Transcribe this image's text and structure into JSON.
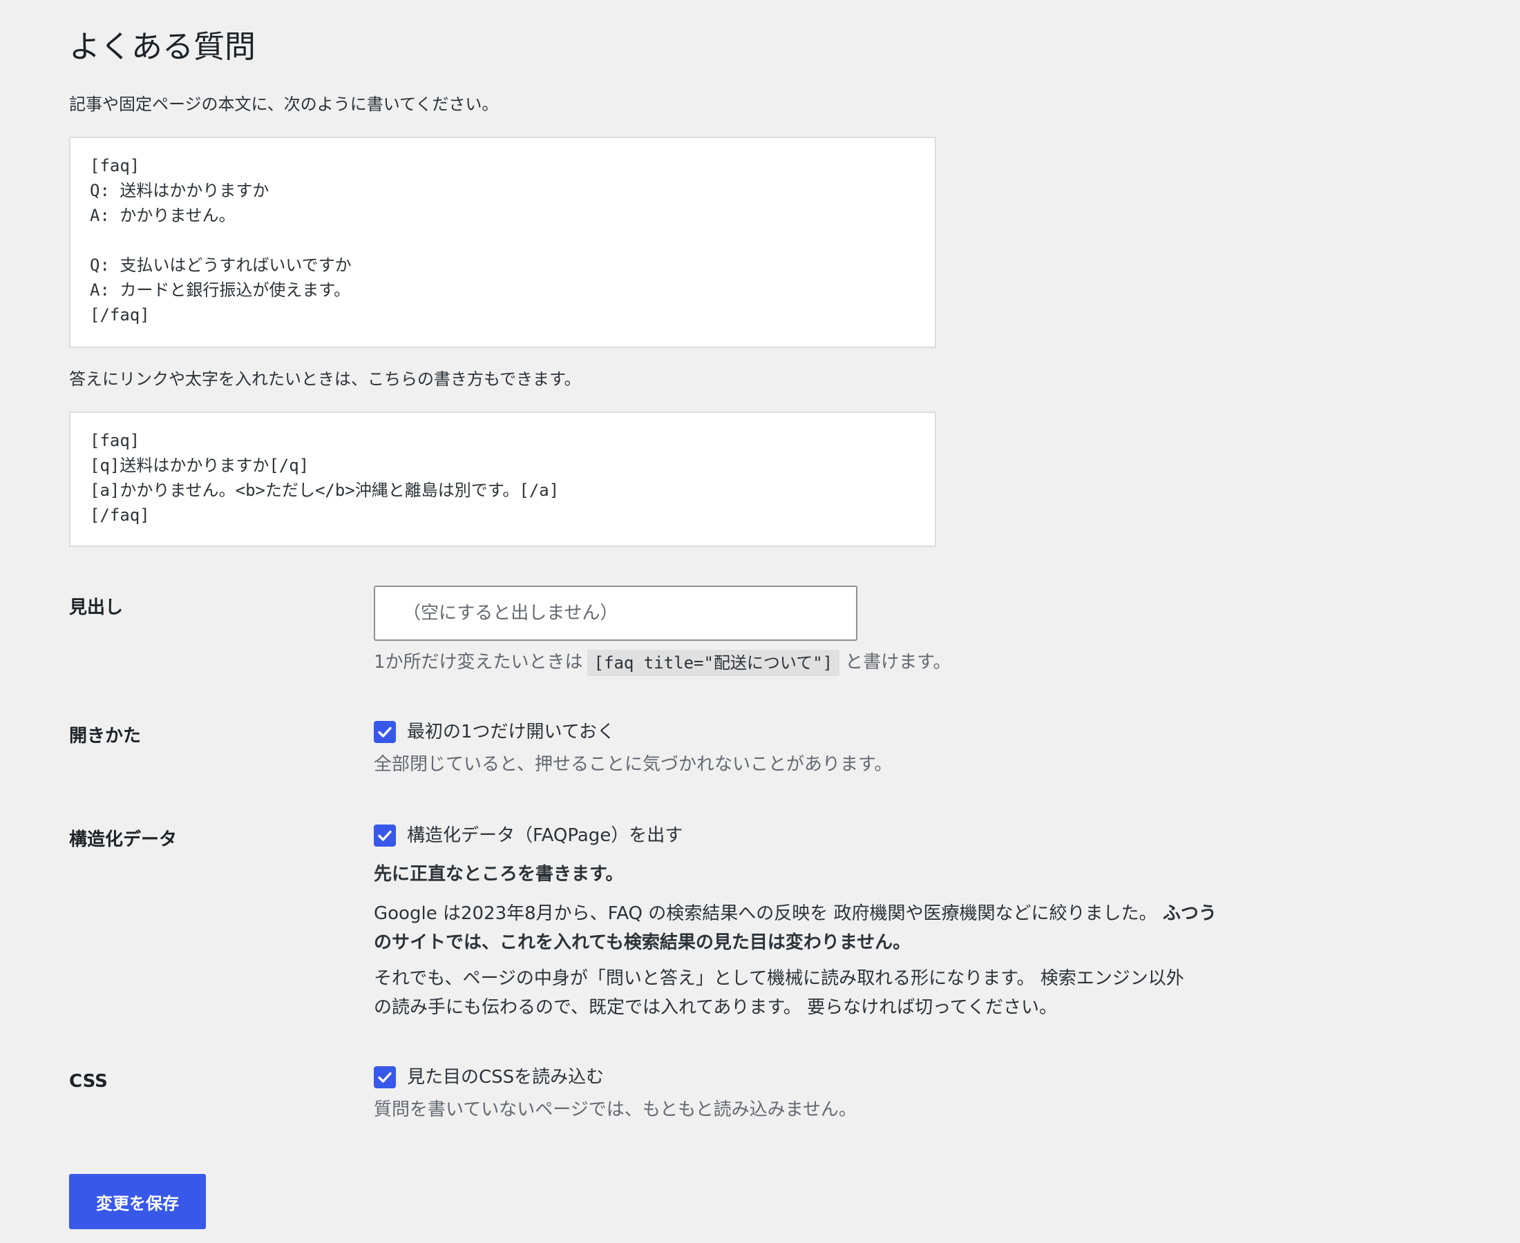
{
  "page": {
    "title": "よくある質問",
    "intro": "記事や固定ページの本文に、次のように書いてください。",
    "example1": "[faq]\nQ: 送料はかかりますか\nA: かかりません。\n\nQ: 支払いはどうすればいいですか\nA: カードと銀行振込が使えます。\n[/faq]",
    "intro2": "答えにリンクや太字を入れたいときは、こちらの書き方もできます。",
    "example2": "[faq]\n[q]送料はかかりますか[/q]\n[a]かかりません。<b>ただし</b>沖縄と離島は別です。[/a]\n[/faq]"
  },
  "heading_row": {
    "label": "見出し",
    "input_value": "",
    "input_placeholder": "（空にすると出しません）",
    "help_before": "1か所だけ変えたいときは",
    "help_code": "[faq title=\"配送について\"]",
    "help_after": "と書けます。"
  },
  "open_row": {
    "label": "開きかた",
    "checkbox_label": "最初の1つだけ開いておく",
    "checked": true,
    "description": "全部閉じていると、押せることに気づかれないことがあります。"
  },
  "schema_row": {
    "label": "構造化データ",
    "checkbox_label": "構造化データ（FAQPage）を出す",
    "checked": true,
    "note_heading": "先に正直なところを書きます。",
    "para1_line1_normal": "Google は2023年8月から、FAQ の検索結果への反映を 政府機関や医療機関などに絞りました。",
    "para1_line1_bold": "ふつう",
    "para1_line2_bold": "のサイトでは、これを入れても検索結果の見た目は変わりません。",
    "para2_line1": "それでも、ページの中身が「問いと答え」として機械に読み取れる形になります。 検索エンジン以外",
    "para2_line2": "の読み手にも伝わるので、既定では入れてあります。 要らなければ切ってください。"
  },
  "css_row": {
    "label": "CSS",
    "checkbox_label": "見た目のCSSを読み込む",
    "checked": true,
    "description": "質問を書いていないページでは、もともと読み込みません。"
  },
  "actions": {
    "save_label": "変更を保存"
  },
  "colors": {
    "accent": "#3858e9",
    "background": "#f0f0f1",
    "text": "#1d2327",
    "muted_text": "#646970"
  }
}
